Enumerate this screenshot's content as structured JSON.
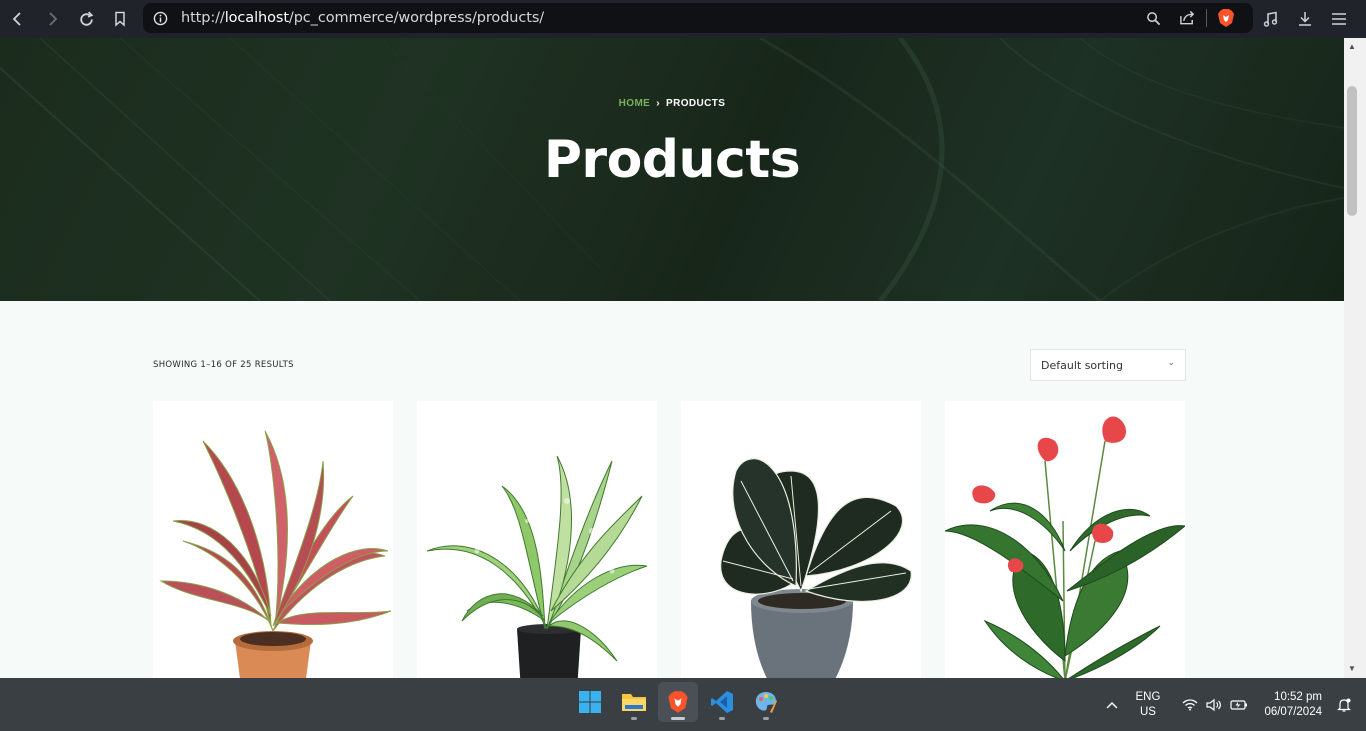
{
  "browser": {
    "url_prefix": "http://",
    "url_host": "localhost",
    "url_path": "/pc_commerce/wordpress/products/"
  },
  "hero": {
    "breadcrumb_home": "HOME",
    "breadcrumb_separator": "›",
    "breadcrumb_current": "PRODUCTS",
    "title": "Products"
  },
  "shop": {
    "result_count": "SHOWING 1–16 OF 25 RESULTS",
    "sorting_selected": "Default sorting",
    "products": [
      {
        "image": "aglaonema-red-plant"
      },
      {
        "image": "dieffenbachia-plant"
      },
      {
        "image": "alocasia-black-velvet-plant"
      },
      {
        "image": "anthurium-red-plant"
      }
    ]
  },
  "taskbar": {
    "apps": [
      "windows-start",
      "file-explorer",
      "brave-browser",
      "vs-code",
      "paint"
    ],
    "lang_line1": "ENG",
    "lang_line2": "US",
    "time": "10:52 pm",
    "date": "06/07/2024"
  },
  "colors": {
    "breadcrumb_accent": "#78b060",
    "toolbar_bg": "#20232a",
    "taskbar_bg": "#3a3f44"
  }
}
